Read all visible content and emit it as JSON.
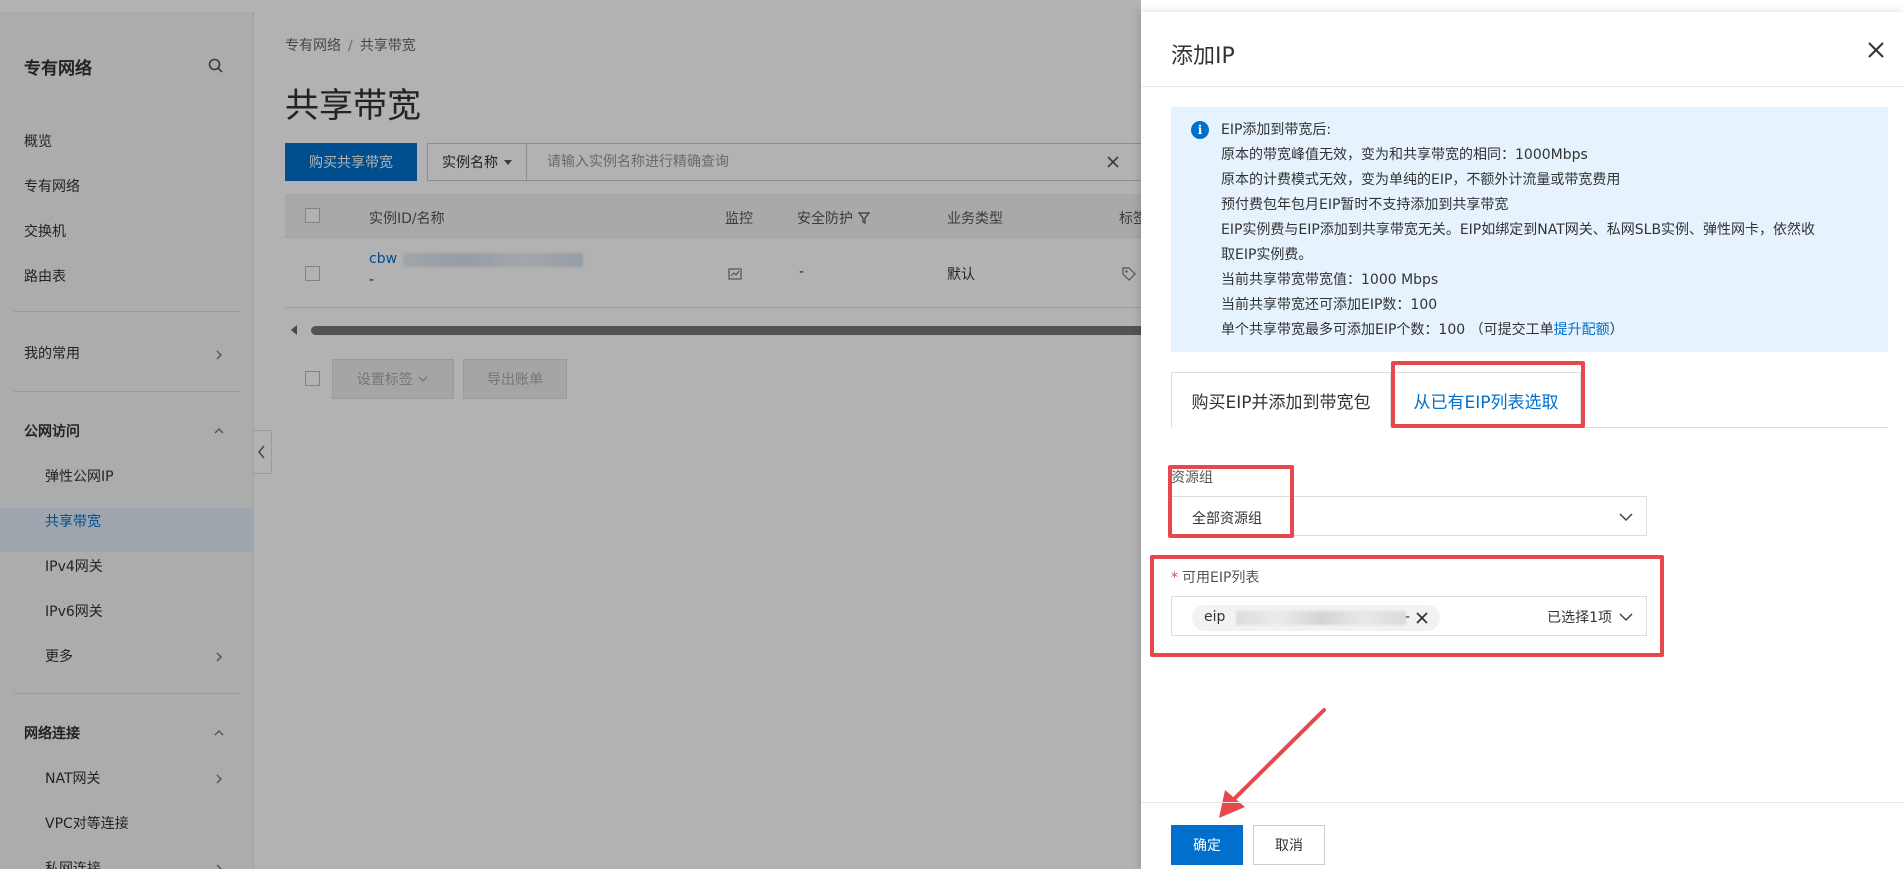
{
  "sidebar": {
    "title": "专有网络",
    "items": [
      {
        "label": "概览"
      },
      {
        "label": "专有网络"
      },
      {
        "label": "交换机"
      },
      {
        "label": "路由表"
      },
      {
        "label": "我的常用"
      },
      {
        "label": "公网访问"
      },
      {
        "label": "弹性公网IP"
      },
      {
        "label": "共享带宽"
      },
      {
        "label": "IPv4网关"
      },
      {
        "label": "IPv6网关"
      },
      {
        "label": "更多"
      },
      {
        "label": "网络连接"
      },
      {
        "label": "NAT网关"
      },
      {
        "label": "VPC对等连接"
      },
      {
        "label": "私网连接"
      }
    ]
  },
  "main": {
    "breadcrumb": [
      "专有网络",
      "共享带宽"
    ],
    "breadcrumb_sep": "/",
    "title": "共享带宽",
    "buy_button": "购买共享带宽",
    "filter_select": "实例名称",
    "search_placeholder": "请输入实例名称进行精确查询",
    "columns": [
      "实例ID/名称",
      "监控",
      "安全防护",
      "业务类型",
      "标签"
    ],
    "row": {
      "id_prefix": "cbw",
      "id_second_line": "-",
      "security": "-",
      "business_type": "默认"
    },
    "bottom_buttons": [
      "设置标签",
      "导出账单"
    ]
  },
  "drawer": {
    "title": "添加IP",
    "notice": {
      "heading": "EIP添加到带宽后:",
      "lines": [
        "原本的带宽峰值无效，变为和共享带宽的相同：1000Mbps",
        "原本的计费模式无效，变为单纯的EIP，不额外计流量或带宽费用",
        "预付费包年包月EIP暂时不支持添加到共享带宽",
        "EIP实例费与EIP添加到共享带宽无关。EIP如绑定到NAT网关、私网SLB实例、弹性网卡，依然收",
        "取EIP实例费。",
        "当前共享带宽带宽值：1000 Mbps",
        "当前共享带宽还可添加EIP数：100"
      ],
      "last_line_prefix": "单个共享带宽最多可添加EIP个数：100 （可提交工单",
      "last_line_link": "提升配额",
      "last_line_suffix": "）"
    },
    "tabs": [
      "购买EIP并添加到带宽包",
      "从已有EIP列表选取"
    ],
    "active_tab": 1,
    "resource_group": {
      "label": "资源组",
      "value": "全部资源组"
    },
    "eip_list": {
      "required_mark": "*",
      "label": "可用EIP列表",
      "tag_prefix": "eip",
      "tag_suffix": "-",
      "selected_text": "已选择1项"
    },
    "confirm_button": "确定",
    "cancel_button": "取消"
  },
  "colors": {
    "primary": "#0070cc",
    "highlight": "#e5484d",
    "notice_bg": "#e6f3ff"
  }
}
